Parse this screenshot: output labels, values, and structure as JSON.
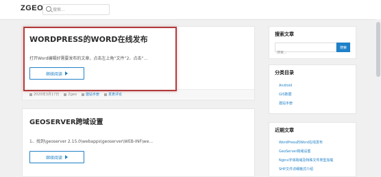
{
  "header": {
    "logo": "ZGEO",
    "search_placeholder": "搜索..."
  },
  "posts": [
    {
      "title": "WORDPRESS的WORD在线发布",
      "excerpt": "打开Word编辑好需要发布的文章，点击左上角“文件”2、点击“...",
      "read_more": "继续阅读",
      "meta": {
        "date": "2020年3月17日",
        "author": "Zgeo",
        "category": "建站手册",
        "comment": "发表评论"
      }
    },
    {
      "title": "GEOSERVER跨域设置",
      "excerpt": "1、找到\\geoserver 2.15.0\\webapps\\geoserver\\WEB-INF\\we...",
      "read_more": "继续阅读"
    }
  ],
  "sidebar": {
    "search_widget": {
      "title": "搜索文章",
      "placeholder": "搜索...",
      "button": "搜索"
    },
    "categories_widget": {
      "title": "分类目录",
      "items": [
        "Android",
        "GIS数据",
        "建站手册"
      ]
    },
    "recent_widget": {
      "title": "近期文章",
      "items": [
        "WordPress的Word在线发布",
        "GeoServer跨域设置",
        "Nginx字体跨域及特殊文件类型加载",
        "SHP文件详细格式介绍"
      ]
    }
  }
}
